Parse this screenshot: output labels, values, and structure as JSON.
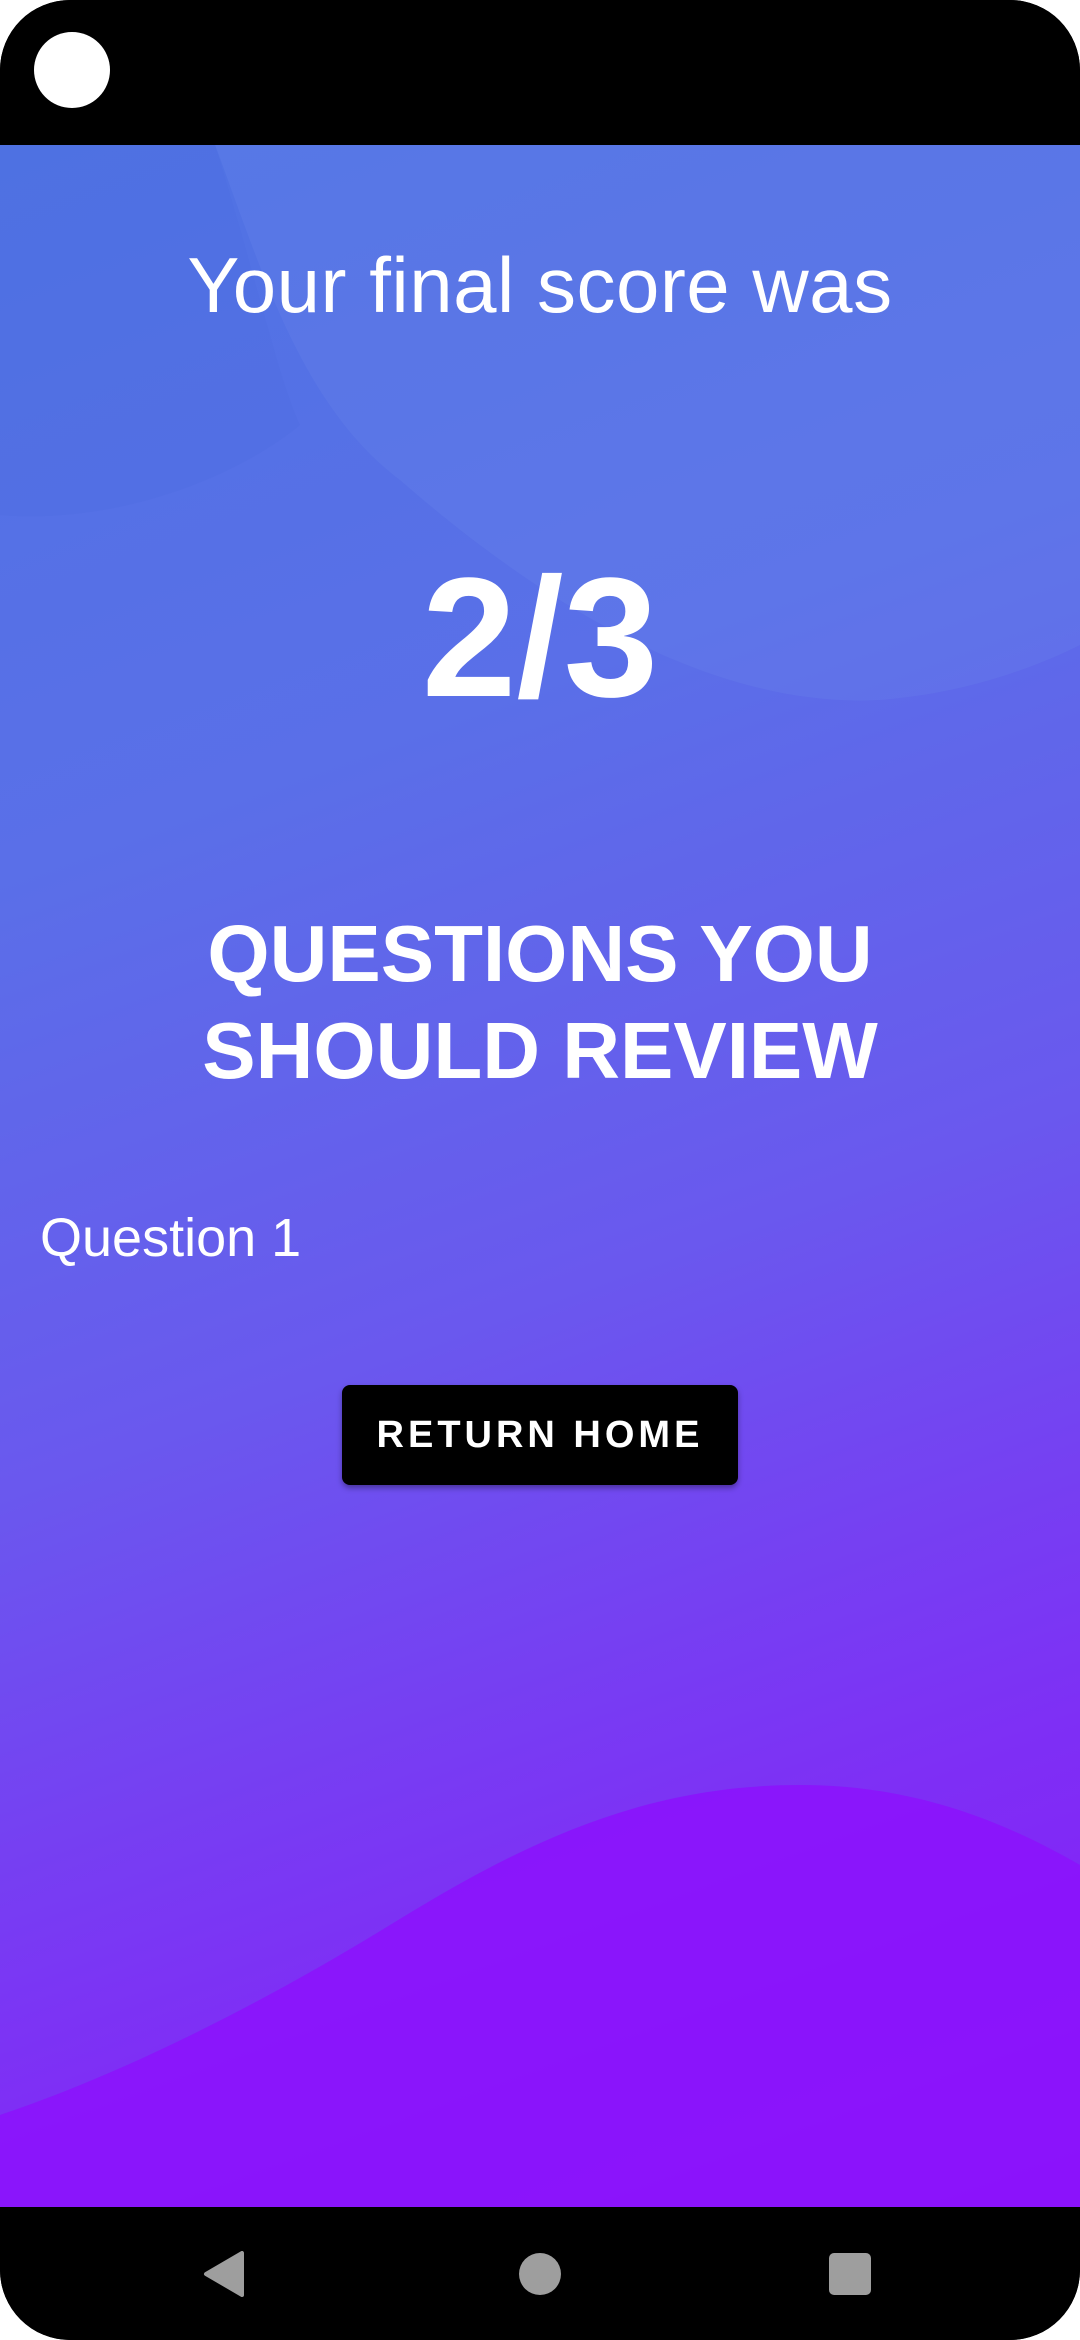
{
  "status_bar": {
    "camera_icon": "camera-cutout-icon"
  },
  "result": {
    "caption": "Your final score was",
    "score": "2/3"
  },
  "review": {
    "heading": "QUESTIONS YOU SHOULD REVIEW",
    "items": [
      {
        "label": "Question 1"
      }
    ]
  },
  "actions": {
    "return_home_label": "RETURN HOME"
  },
  "nav": {
    "back_icon": "back-triangle-icon",
    "home_icon": "home-circle-icon",
    "recents_icon": "recents-square-icon"
  },
  "colors": {
    "gradient_top": "#4f73e3",
    "gradient_bottom": "#8818f8",
    "button_bg": "#000000",
    "text": "#ffffff",
    "nav_icon": "#9e9e9e"
  }
}
